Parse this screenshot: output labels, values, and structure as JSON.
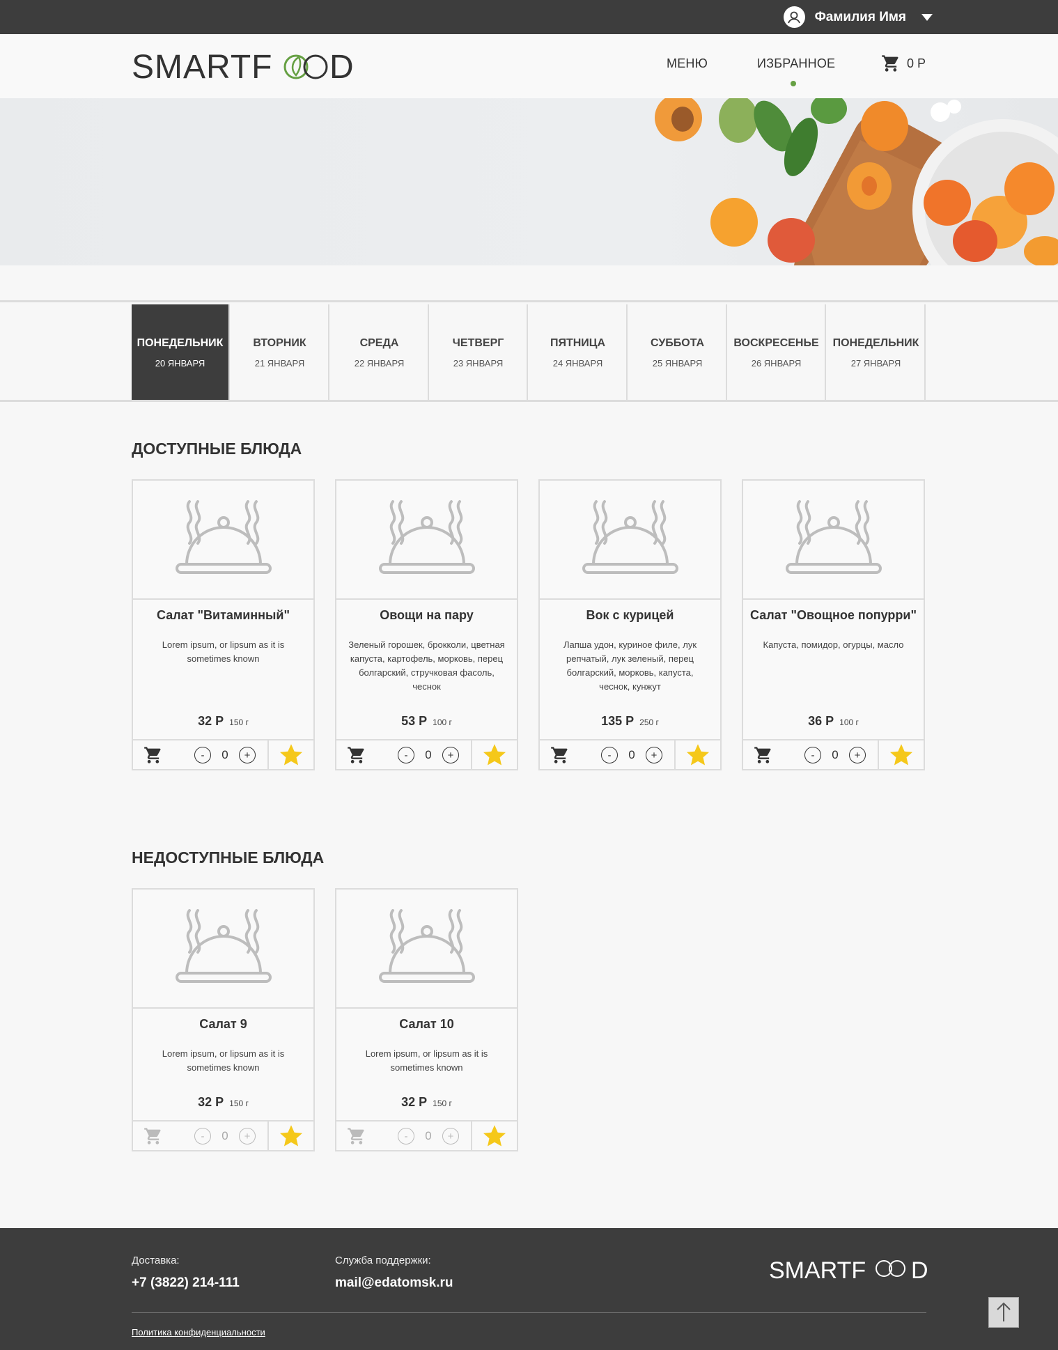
{
  "topbar": {
    "user_name": "Фамилия Имя"
  },
  "header": {
    "logo_text_left": "SMARTF",
    "logo_text_right": "D",
    "nav": {
      "menu": "МЕНЮ",
      "favorites": "ИЗБРАННОЕ"
    },
    "cart_total": "0 Р"
  },
  "days": [
    {
      "name": "ПОНЕДЕЛЬНИК",
      "date": "20 ЯНВАРЯ",
      "active": true
    },
    {
      "name": "ВТОРНИК",
      "date": "21 ЯНВАРЯ"
    },
    {
      "name": "СРЕДА",
      "date": "22 ЯНВАРЯ"
    },
    {
      "name": "ЧЕТВЕРГ",
      "date": "23 ЯНВАРЯ"
    },
    {
      "name": "ПЯТНИЦА",
      "date": "24 ЯНВАРЯ"
    },
    {
      "name": "СУББОТА",
      "date": "25 ЯНВАРЯ"
    },
    {
      "name": "ВОСКРЕСЕНЬЕ",
      "date": "26 ЯНВАРЯ"
    },
    {
      "name": "ПОНЕДЕЛЬНИК",
      "date": "27 ЯНВАРЯ"
    }
  ],
  "available": {
    "title": "ДОСТУПНЫЕ БЛЮДА",
    "dishes": [
      {
        "name": "Салат \"Витаминный\"",
        "desc": "Lorem ipsum, or lipsum as it is sometimes known",
        "price": "32 Р",
        "weight": "150 г",
        "qty": "0"
      },
      {
        "name": "Овощи на пару",
        "desc": "Зеленый горошек, брокколи, цветная капуста, картофель, морковь, перец болгарский, стручковая фасоль, чеснок",
        "price": "53 Р",
        "weight": "100 г",
        "qty": "0"
      },
      {
        "name": "Вок с курицей",
        "desc": "Лапша удон, куриное филе, лук репчатый, лук зеленый, перец болгарский, морковь, капуста, чеснок, кунжут",
        "price": "135 Р",
        "weight": "250 г",
        "qty": "0"
      },
      {
        "name": "Салат \"Овощное попурри\"",
        "desc": "Капуста, помидор, огурцы, масло",
        "price": "36 Р",
        "weight": "100 г",
        "qty": "0"
      }
    ]
  },
  "unavailable": {
    "title": "НЕДОСТУПНЫЕ БЛЮДА",
    "dishes": [
      {
        "name": "Салат 9",
        "desc": "Lorem ipsum, or lipsum as it is sometimes known",
        "price": "32 Р",
        "weight": "150 г",
        "qty": "0"
      },
      {
        "name": "Салат 10",
        "desc": "Lorem ipsum, or lipsum as it is sometimes known",
        "price": "32 Р",
        "weight": "150 г",
        "qty": "0"
      }
    ]
  },
  "controls": {
    "minus": "-",
    "plus": "+"
  },
  "footer": {
    "delivery_label": "Доставка:",
    "delivery_phone": "+7 (3822) 214-111",
    "support_label": "Служба поддержки:",
    "support_email": "mail@edatomsk.ru",
    "privacy_link": "Политика конфиденциальности",
    "logo_text_left": "SMARTF",
    "logo_text_right": "D"
  },
  "colors": {
    "dark": "#3d3d3d",
    "accent_green": "#66a043",
    "star_yellow": "#f5c81a",
    "border": "#dcdcdc"
  },
  "icons": [
    "user-icon",
    "caret-down-icon",
    "cart-icon",
    "cloche-icon",
    "star-icon",
    "arrow-up-icon"
  ]
}
